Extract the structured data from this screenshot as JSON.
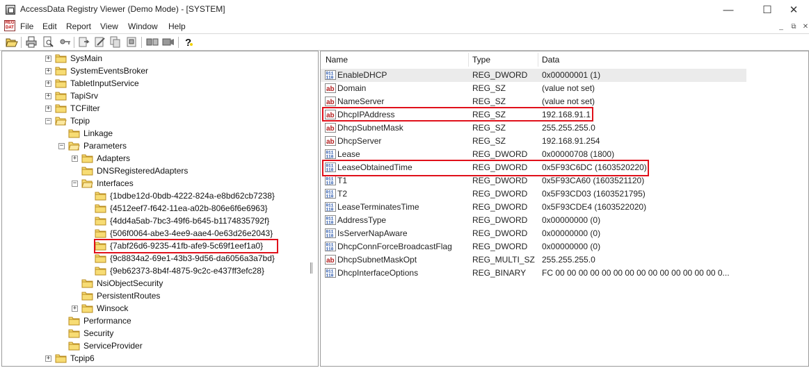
{
  "window": {
    "title": "AccessData Registry Viewer (Demo Mode) - [SYSTEM]",
    "minimize_glyph": "—",
    "maximize_glyph": "☐",
    "close_glyph": "✕"
  },
  "menu": {
    "items": [
      "File",
      "Edit",
      "Report",
      "View",
      "Window",
      "Help"
    ],
    "mdi_minimize": "_",
    "mdi_restore": "⧉",
    "mdi_close": "✕"
  },
  "toolbar": {
    "icons": [
      "open-icon",
      "print-icon",
      "print-preview-icon",
      "key-icon",
      "export-icon",
      "edit-icon",
      "copy-icon",
      "properties-icon",
      "binary-view-icon",
      "hex-view-icon",
      "help-icon"
    ]
  },
  "tree": {
    "nodes": [
      {
        "label": "SysMain",
        "expander": "+"
      },
      {
        "label": "SystemEventsBroker",
        "expander": "+"
      },
      {
        "label": "TabletInputService",
        "expander": "+"
      },
      {
        "label": "TapiSrv",
        "expander": "+"
      },
      {
        "label": "TCFilter",
        "expander": "+"
      },
      {
        "label": "Tcpip",
        "expander": "−"
      },
      {
        "label": "Linkage",
        "expander": ""
      },
      {
        "label": "Parameters",
        "expander": "−"
      },
      {
        "label": "Adapters",
        "expander": "+"
      },
      {
        "label": "DNSRegisteredAdapters",
        "expander": ""
      },
      {
        "label": "Interfaces",
        "expander": "−"
      },
      {
        "label": "{1bdbe12d-0bdb-4222-824a-e8bd62cb7238}",
        "expander": ""
      },
      {
        "label": "{4512eef7-f642-11ea-a02b-806e6f6e6963}",
        "expander": ""
      },
      {
        "label": "{4dd4a5ab-7bc3-49f6-b645-b1174835792f}",
        "expander": ""
      },
      {
        "label": "{506f0064-abe3-4ee9-aae4-0e63d26e2043}",
        "expander": ""
      },
      {
        "label": "{7abf26d6-9235-41fb-afe9-5c69f1eef1a0}",
        "expander": ""
      },
      {
        "label": "{9c8834a2-69e1-43b3-9d56-da6056a3a7bd}",
        "expander": ""
      },
      {
        "label": "{9eb62373-8b4f-4875-9c2c-e437ff3efc28}",
        "expander": ""
      },
      {
        "label": "NsiObjectSecurity",
        "expander": ""
      },
      {
        "label": "PersistentRoutes",
        "expander": ""
      },
      {
        "label": "Winsock",
        "expander": "+"
      },
      {
        "label": "Performance",
        "expander": ""
      },
      {
        "label": "Security",
        "expander": ""
      },
      {
        "label": "ServiceProvider",
        "expander": ""
      },
      {
        "label": "Tcpip6",
        "expander": "+"
      }
    ]
  },
  "list": {
    "columns": [
      "Name",
      "Type",
      "Data"
    ],
    "rows": [
      {
        "name": "EnableDHCP",
        "type": "REG_DWORD",
        "data": "0x00000001 (1)",
        "icon": "binary-value-icon"
      },
      {
        "name": "Domain",
        "type": "REG_SZ",
        "data": "(value not set)",
        "icon": "string-value-icon"
      },
      {
        "name": "NameServer",
        "type": "REG_SZ",
        "data": "(value not set)",
        "icon": "string-value-icon"
      },
      {
        "name": "DhcpIPAddress",
        "type": "REG_SZ",
        "data": "192.168.91.1",
        "icon": "string-value-icon"
      },
      {
        "name": "DhcpSubnetMask",
        "type": "REG_SZ",
        "data": "255.255.255.0",
        "icon": "string-value-icon"
      },
      {
        "name": "DhcpServer",
        "type": "REG_SZ",
        "data": "192.168.91.254",
        "icon": "string-value-icon"
      },
      {
        "name": "Lease",
        "type": "REG_DWORD",
        "data": "0x00000708 (1800)",
        "icon": "binary-value-icon"
      },
      {
        "name": "LeaseObtainedTime",
        "type": "REG_DWORD",
        "data": "0x5F93C6DC (1603520220)",
        "icon": "binary-value-icon"
      },
      {
        "name": "T1",
        "type": "REG_DWORD",
        "data": "0x5F93CA60 (1603521120)",
        "icon": "binary-value-icon"
      },
      {
        "name": "T2",
        "type": "REG_DWORD",
        "data": "0x5F93CD03 (1603521795)",
        "icon": "binary-value-icon"
      },
      {
        "name": "LeaseTerminatesTime",
        "type": "REG_DWORD",
        "data": "0x5F93CDE4 (1603522020)",
        "icon": "binary-value-icon"
      },
      {
        "name": "AddressType",
        "type": "REG_DWORD",
        "data": "0x00000000 (0)",
        "icon": "binary-value-icon"
      },
      {
        "name": "IsServerNapAware",
        "type": "REG_DWORD",
        "data": "0x00000000 (0)",
        "icon": "binary-value-icon"
      },
      {
        "name": "DhcpConnForceBroadcastFlag",
        "type": "REG_DWORD",
        "data": "0x00000000 (0)",
        "icon": "binary-value-icon"
      },
      {
        "name": "DhcpSubnetMaskOpt",
        "type": "REG_MULTI_SZ",
        "data": "255.255.255.0",
        "icon": "string-value-icon"
      },
      {
        "name": "DhcpInterfaceOptions",
        "type": "REG_BINARY",
        "data": "FC 00 00 00 00 00 00 00 00 00 00 00 00 00 00 0...",
        "icon": "binary-value-icon"
      }
    ]
  },
  "colors": {
    "highlight_border": "#e0101a",
    "selected_row": "#ebebeb",
    "folder_fill": "#f7dc74",
    "folder_edge": "#b98b1e",
    "string_icon": "#b41e1e",
    "binary_icon": "#1f4fa8"
  }
}
